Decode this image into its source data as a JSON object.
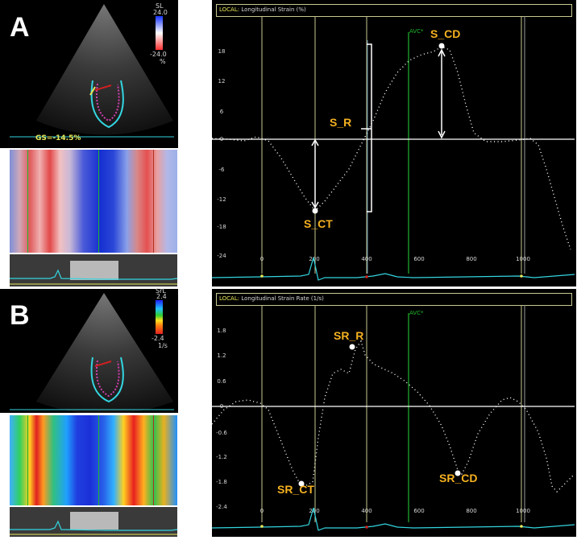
{
  "panel_a": {
    "letter": "A",
    "colorbar": {
      "label": "SL",
      "max": "24.0",
      "min": "-24.0",
      "unit": "%"
    },
    "gs_label": "GS=-14.5%",
    "title_prefix": "LOCAL:",
    "title": "Longitudinal Strain (%)",
    "avc_label": "AVC*",
    "y_ticks": [
      "18",
      "12",
      "6",
      "0",
      "-6",
      "-12",
      "-18",
      "-24"
    ],
    "x_ticks": [
      "0",
      "200",
      "400",
      "600",
      "800",
      "1000"
    ],
    "annotations": {
      "s_cd": "S_CD",
      "s_r": "S_R",
      "s_ct": "S_CT"
    }
  },
  "panel_b": {
    "letter": "B",
    "colorbar": {
      "label": "SrL",
      "max": "2.4",
      "min": "-2.4",
      "unit": "1/s"
    },
    "title_prefix": "LOCAL:",
    "title": "Longitudinal Strain Rate (1/s)",
    "avc_label": "AVC*",
    "y_ticks": [
      "1.8",
      "1.2",
      "0.6",
      "0",
      "-0.6",
      "-1.2",
      "-1.8",
      "-2.4"
    ],
    "x_ticks": [
      "0",
      "200",
      "400",
      "600",
      "800",
      "1000"
    ],
    "annotations": {
      "sr_r": "SR_R",
      "sr_ct": "SR_CT",
      "sr_cd": "SR_CD"
    }
  },
  "colors": {
    "annotation": "#f5b120",
    "ecg": "#33d5e0",
    "marker_yellow": "#e8e85a",
    "marker_green": "#1fb52c",
    "axis": "#ffffff"
  }
}
